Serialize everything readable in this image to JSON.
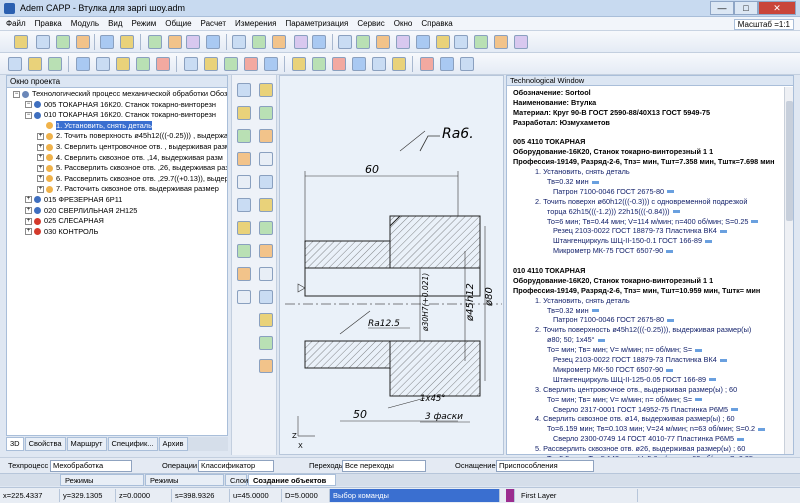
{
  "window": {
    "title": "Adem CAPP - Втулка для заргi шоу.adm",
    "minimize": "—",
    "maximize": "□",
    "close": "✕"
  },
  "menu": [
    "Файл",
    "Правка",
    "Модуль",
    "Вид",
    "Режим",
    "Общие",
    "Расчет",
    "Измерения",
    "Параметризация",
    "Сервис",
    "Окно",
    "Справка"
  ],
  "scale": "Масштаб =1:1",
  "left_panel": {
    "title": "Окно проекта",
    "tree": [
      {
        "text": "Технологический процесс механической обработки  Обоз",
        "level": 0,
        "icon": "process",
        "exp": "−"
      },
      {
        "text": "005  ТОКАРНАЯ 16К20. Станок токарно-винторезн",
        "level": 1,
        "icon": "op",
        "exp": "−"
      },
      {
        "text": "010  ТОКАРНАЯ 16К20. Станок токарно-винторезн",
        "level": 1,
        "icon": "op",
        "exp": "−"
      },
      {
        "text": "1. Установить, снять деталь",
        "level": 2,
        "icon": "step",
        "exp": "",
        "selected": true
      },
      {
        "text": "2. Точить поверхность  ø45h12(((-0.25))) , выдержа",
        "level": 2,
        "icon": "step",
        "exp": "+"
      },
      {
        "text": "3. Сверлить центровочное отв. , выдерживая разм",
        "level": 2,
        "icon": "step",
        "exp": "+"
      },
      {
        "text": "4. Сверлить сквозное отв. ,14, выдерживая разм",
        "level": 2,
        "icon": "step",
        "exp": "+"
      },
      {
        "text": "5. Рассверлить сквозное отв. ,26, выдерживая разм",
        "level": 2,
        "icon": "step",
        "exp": "+"
      },
      {
        "text": "6. Рассверлить сквозное отв. ,29.7((+0.13)), выдерж",
        "level": 2,
        "icon": "step",
        "exp": "+"
      },
      {
        "text": "7. Расточить сквозное отв. выдерживая размер",
        "level": 2,
        "icon": "step",
        "exp": "+"
      },
      {
        "text": "015  ФРЕЗЕРНАЯ 6Р11",
        "level": 1,
        "icon": "op",
        "exp": "+"
      },
      {
        "text": "020  СВЕРЛИЛЬНАЯ 2Н125",
        "level": 1,
        "icon": "op",
        "exp": "+"
      },
      {
        "text": "025  СЛЕСАРНАЯ",
        "level": 1,
        "icon": "red",
        "exp": "+"
      },
      {
        "text": "030  КОНТРОЛЬ",
        "level": 1,
        "icon": "red",
        "exp": "+"
      }
    ],
    "tabs": [
      "3D",
      "Свойства",
      "Маршрут",
      "Специфик...",
      "Архив"
    ]
  },
  "drawing": {
    "roughness": "Ra6.",
    "dim_top": "60",
    "dim_45": "ø45h12",
    "dim_80": "ø80",
    "dim_30": "ø30H7(+0.021)",
    "ra_inner": "Ra12.5",
    "chamfer": "1x45°",
    "chamfer_note": "3 фаски",
    "dim_bottom": "50",
    "axis_z": "Z",
    "axis_x": "X"
  },
  "tech_window": {
    "title": "Technological Window",
    "lines": [
      {
        "t": "Обозначение:   Sortool",
        "c": "b",
        "i": 0
      },
      {
        "t": "Наименование:  Втулка",
        "c": "b",
        "i": 0
      },
      {
        "t": "Материал:  Круг 90-В ГОСТ 2590-88/40Х13 ГОСТ 5949-75",
        "c": "b",
        "i": 0
      },
      {
        "t": "Разработал:   Юзмухаметов",
        "c": "b",
        "i": 0
      },
      {
        "t": "",
        "c": "",
        "i": 0
      },
      {
        "t": "005    4110 ТОКАРНАЯ",
        "c": "b",
        "i": 0
      },
      {
        "t": "Оборудование-16К20, Станок токарно-винторезный 1  1",
        "c": "b",
        "i": 0
      },
      {
        "t": "Профессия-19149, Разряд-2-6, Тпз= мин, Тшт=7.358 мин, Тштк=7.698 мин",
        "c": "b",
        "i": 0
      },
      {
        "t": "1. Установить, снять деталь",
        "c": "blue",
        "i": 1
      },
      {
        "t": "Тв=0.32 мин",
        "c": "blue",
        "i": 2
      },
      {
        "t": "Патрон 7100-0046 ГОСТ 2675-80",
        "c": "blue",
        "i": 3
      },
      {
        "t": "2. Точить поверхн  ø60h12(((-0.3))) с одновременной подрезкой",
        "c": "blue",
        "i": 1
      },
      {
        "t": "торца 62h15(((-1.2))) 22h15(((-0.84)))",
        "c": "blue",
        "i": 2
      },
      {
        "t": "То=6 мин; Тв=0.44 мин; V=114 м/мин; n=400 об/мин; S=0.25",
        "c": "blue",
        "i": 2
      },
      {
        "t": "Резец 2103-0022 ГОСТ 18879-73 Пластинка ВК4",
        "c": "blue",
        "i": 3
      },
      {
        "t": "Штангенциркуль ШЦ-II-150-0.1 ГОСТ 166-89",
        "c": "blue",
        "i": 3
      },
      {
        "t": "Микрометр МК-75 ГОСТ 6507-90",
        "c": "blue",
        "i": 3
      },
      {
        "t": "",
        "c": "",
        "i": 0
      },
      {
        "t": "010    4110 ТОКАРНАЯ",
        "c": "b",
        "i": 0
      },
      {
        "t": "Оборудование-16К20, Станок токарно-винторезный 1  1",
        "c": "b",
        "i": 0
      },
      {
        "t": "Профессия-19149, Разряд-2-6, Тпз= мин, Тшт=10.959 мин, Тштк= мин",
        "c": "b",
        "i": 0
      },
      {
        "t": "1. Установить, снять деталь",
        "c": "blue",
        "i": 1
      },
      {
        "t": "Тв=0.32 мин",
        "c": "blue",
        "i": 2
      },
      {
        "t": "Патрон 7100-0046 ГОСТ 2675-80",
        "c": "blue",
        "i": 3
      },
      {
        "t": "2. Точить поверхность  ø45h12(((-0.25))), выдерживая размер(ы)",
        "c": "blue",
        "i": 1
      },
      {
        "t": "ø80; 50; 1x45°",
        "c": "blue",
        "i": 2
      },
      {
        "t": "То= мин; Тв= мин; V= м/мин; n= об/мин; S=",
        "c": "blue",
        "i": 2
      },
      {
        "t": "Резец 2103-0022 ГОСТ 18879-73 Пластинка ВК4",
        "c": "blue",
        "i": 3
      },
      {
        "t": "Микрометр МК-50 ГОСТ 6507-90",
        "c": "blue",
        "i": 3
      },
      {
        "t": "Штангенциркуль ШЦ-II-125-0.05 ГОСТ 166-89",
        "c": "blue",
        "i": 3
      },
      {
        "t": "3. Сверлить центровочное отв., выдерживая размер(ы) ; 60",
        "c": "blue",
        "i": 1
      },
      {
        "t": "То= мин; Тв= мин; V= м/мин; n= об/мин; S=",
        "c": "blue",
        "i": 2
      },
      {
        "t": "Сверло 2317-0001 ГОСТ 14952-75 Пластинка Р6М5",
        "c": "blue",
        "i": 3
      },
      {
        "t": "4. Сверлить сквозное отв. ø14, выдерживая размер(ы) ; 60",
        "c": "blue",
        "i": 1
      },
      {
        "t": "То=6.159 мин; Тв=0.103 мин; V=24 м/мин; n=63 об/мин; S=0.2",
        "c": "blue",
        "i": 2
      },
      {
        "t": "Сверло 2300-0749 14 ГОСТ 4010-77 Пластинка Р6М5",
        "c": "blue",
        "i": 3
      },
      {
        "t": "5. Рассверлить сквозное отв. ø26, выдерживая размер(ы) ; 60",
        "c": "blue",
        "i": 1
      },
      {
        "t": "То=5.5 мин; Тв=5.143 мин; V=5.6 м/мин; n=63 об/мин; S=0.35",
        "c": "blue",
        "i": 2
      },
      {
        "t": "Сверло 2301-1739 26 ГОСТ 22736-77 Пластинка Р6М5",
        "c": "blue",
        "i": 3
      },
      {
        "t": "6. Рассверлить сквозное отв. ø29.7((+0.13)), выдерживая размер(ы)",
        "c": "blue",
        "i": 1
      }
    ]
  },
  "bottom_bar": {
    "tp_label": "Техпроцесс",
    "tp_value": "Мехобработка",
    "ops_label": "Операции",
    "ops_value": "Классификатор операц",
    "trans_label": "Переходы",
    "trans_value": "Все переходы",
    "equip_label": "Оснащение",
    "equip_value": "Приспособления"
  },
  "doc_tabs": [
    "Режимы отображения",
    "Режимы построений",
    "Слои",
    "Создание объектов ТП"
  ],
  "status": {
    "x": "x=225.4337",
    "y": "y=329.1305",
    "z": "z=0.0000",
    "s": "s=398.9326",
    "u": "u=45.0000",
    "d": "D=5.0000",
    "cmd": "Выбор команды",
    "layer": "First Layer"
  },
  "colors": {
    "accent": "#3a6fd0",
    "tech_text": "#14226b",
    "layer_swatch": "#9b2d8f",
    "cmd_field": "#3a6fd0"
  }
}
